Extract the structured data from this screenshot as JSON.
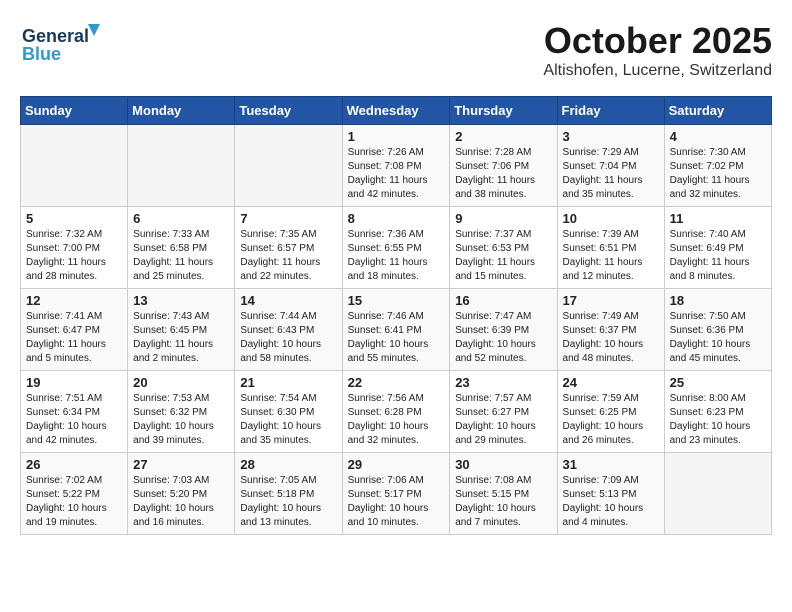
{
  "header": {
    "logo_line1": "General",
    "logo_line2": "Blue",
    "month": "October 2025",
    "location": "Altishofen, Lucerne, Switzerland"
  },
  "weekdays": [
    "Sunday",
    "Monday",
    "Tuesday",
    "Wednesday",
    "Thursday",
    "Friday",
    "Saturday"
  ],
  "weeks": [
    [
      {
        "day": "",
        "info": ""
      },
      {
        "day": "",
        "info": ""
      },
      {
        "day": "",
        "info": ""
      },
      {
        "day": "1",
        "info": "Sunrise: 7:26 AM\nSunset: 7:08 PM\nDaylight: 11 hours\nand 42 minutes."
      },
      {
        "day": "2",
        "info": "Sunrise: 7:28 AM\nSunset: 7:06 PM\nDaylight: 11 hours\nand 38 minutes."
      },
      {
        "day": "3",
        "info": "Sunrise: 7:29 AM\nSunset: 7:04 PM\nDaylight: 11 hours\nand 35 minutes."
      },
      {
        "day": "4",
        "info": "Sunrise: 7:30 AM\nSunset: 7:02 PM\nDaylight: 11 hours\nand 32 minutes."
      }
    ],
    [
      {
        "day": "5",
        "info": "Sunrise: 7:32 AM\nSunset: 7:00 PM\nDaylight: 11 hours\nand 28 minutes."
      },
      {
        "day": "6",
        "info": "Sunrise: 7:33 AM\nSunset: 6:58 PM\nDaylight: 11 hours\nand 25 minutes."
      },
      {
        "day": "7",
        "info": "Sunrise: 7:35 AM\nSunset: 6:57 PM\nDaylight: 11 hours\nand 22 minutes."
      },
      {
        "day": "8",
        "info": "Sunrise: 7:36 AM\nSunset: 6:55 PM\nDaylight: 11 hours\nand 18 minutes."
      },
      {
        "day": "9",
        "info": "Sunrise: 7:37 AM\nSunset: 6:53 PM\nDaylight: 11 hours\nand 15 minutes."
      },
      {
        "day": "10",
        "info": "Sunrise: 7:39 AM\nSunset: 6:51 PM\nDaylight: 11 hours\nand 12 minutes."
      },
      {
        "day": "11",
        "info": "Sunrise: 7:40 AM\nSunset: 6:49 PM\nDaylight: 11 hours\nand 8 minutes."
      }
    ],
    [
      {
        "day": "12",
        "info": "Sunrise: 7:41 AM\nSunset: 6:47 PM\nDaylight: 11 hours\nand 5 minutes."
      },
      {
        "day": "13",
        "info": "Sunrise: 7:43 AM\nSunset: 6:45 PM\nDaylight: 11 hours\nand 2 minutes."
      },
      {
        "day": "14",
        "info": "Sunrise: 7:44 AM\nSunset: 6:43 PM\nDaylight: 10 hours\nand 58 minutes."
      },
      {
        "day": "15",
        "info": "Sunrise: 7:46 AM\nSunset: 6:41 PM\nDaylight: 10 hours\nand 55 minutes."
      },
      {
        "day": "16",
        "info": "Sunrise: 7:47 AM\nSunset: 6:39 PM\nDaylight: 10 hours\nand 52 minutes."
      },
      {
        "day": "17",
        "info": "Sunrise: 7:49 AM\nSunset: 6:37 PM\nDaylight: 10 hours\nand 48 minutes."
      },
      {
        "day": "18",
        "info": "Sunrise: 7:50 AM\nSunset: 6:36 PM\nDaylight: 10 hours\nand 45 minutes."
      }
    ],
    [
      {
        "day": "19",
        "info": "Sunrise: 7:51 AM\nSunset: 6:34 PM\nDaylight: 10 hours\nand 42 minutes."
      },
      {
        "day": "20",
        "info": "Sunrise: 7:53 AM\nSunset: 6:32 PM\nDaylight: 10 hours\nand 39 minutes."
      },
      {
        "day": "21",
        "info": "Sunrise: 7:54 AM\nSunset: 6:30 PM\nDaylight: 10 hours\nand 35 minutes."
      },
      {
        "day": "22",
        "info": "Sunrise: 7:56 AM\nSunset: 6:28 PM\nDaylight: 10 hours\nand 32 minutes."
      },
      {
        "day": "23",
        "info": "Sunrise: 7:57 AM\nSunset: 6:27 PM\nDaylight: 10 hours\nand 29 minutes."
      },
      {
        "day": "24",
        "info": "Sunrise: 7:59 AM\nSunset: 6:25 PM\nDaylight: 10 hours\nand 26 minutes."
      },
      {
        "day": "25",
        "info": "Sunrise: 8:00 AM\nSunset: 6:23 PM\nDaylight: 10 hours\nand 23 minutes."
      }
    ],
    [
      {
        "day": "26",
        "info": "Sunrise: 7:02 AM\nSunset: 5:22 PM\nDaylight: 10 hours\nand 19 minutes."
      },
      {
        "day": "27",
        "info": "Sunrise: 7:03 AM\nSunset: 5:20 PM\nDaylight: 10 hours\nand 16 minutes."
      },
      {
        "day": "28",
        "info": "Sunrise: 7:05 AM\nSunset: 5:18 PM\nDaylight: 10 hours\nand 13 minutes."
      },
      {
        "day": "29",
        "info": "Sunrise: 7:06 AM\nSunset: 5:17 PM\nDaylight: 10 hours\nand 10 minutes."
      },
      {
        "day": "30",
        "info": "Sunrise: 7:08 AM\nSunset: 5:15 PM\nDaylight: 10 hours\nand 7 minutes."
      },
      {
        "day": "31",
        "info": "Sunrise: 7:09 AM\nSunset: 5:13 PM\nDaylight: 10 hours\nand 4 minutes."
      },
      {
        "day": "",
        "info": ""
      }
    ]
  ]
}
